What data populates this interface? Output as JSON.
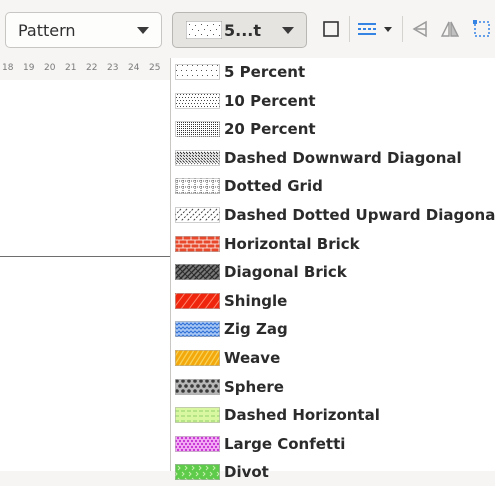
{
  "toolbar": {
    "area_style": {
      "label": "Pattern"
    },
    "pattern": {
      "label": "5...t"
    },
    "icons": [
      "shadow-box-icon",
      "line-style-icon",
      "align-icon",
      "flip-icon",
      "transform-icon"
    ]
  },
  "ruler": {
    "ticks": [
      "18",
      "19",
      "20",
      "21",
      "22",
      "23",
      "24",
      "25"
    ]
  },
  "patterns": [
    {
      "label": "5 Percent",
      "kind": "dots5",
      "fg": "#555555",
      "bg": "#ffffff"
    },
    {
      "label": "10 Percent",
      "kind": "dots10",
      "fg": "#444444",
      "bg": "#ffffff"
    },
    {
      "label": "20 Percent",
      "kind": "dots20",
      "fg": "#333333",
      "bg": "#ffffff"
    },
    {
      "label": "Dashed Downward Diagonal",
      "kind": "diagdown",
      "fg": "#222222",
      "bg": "#ffffff"
    },
    {
      "label": "Dotted Grid",
      "kind": "grid",
      "fg": "#222222",
      "bg": "#ffffff"
    },
    {
      "label": "Dashed Dotted Upward Diagonal",
      "kind": "diagup",
      "fg": "#333333",
      "bg": "#ffffff"
    },
    {
      "label": "Horizontal Brick",
      "kind": "brick",
      "fg": "#ffffff",
      "bg": "#e8472a"
    },
    {
      "label": "Diagonal Brick",
      "kind": "diagbrick",
      "fg": "#2a2a2a",
      "bg": "#7a7a7a"
    },
    {
      "label": "Shingle",
      "kind": "shingle",
      "fg": "#ff8a70",
      "bg": "#f0250d"
    },
    {
      "label": "Zig Zag",
      "kind": "zigzag",
      "fg": "#2f6fd6",
      "bg": "#a9c8f3"
    },
    {
      "label": "Weave",
      "kind": "weave",
      "fg": "#f8d25a",
      "bg": "#f3a90c"
    },
    {
      "label": "Sphere",
      "kind": "sphere",
      "fg": "#3a3a3a",
      "bg": "#b7b7b7"
    },
    {
      "label": "Dashed Horizontal",
      "kind": "dashh",
      "fg": "#8ed16a",
      "bg": "#d9f7a1"
    },
    {
      "label": "Large Confetti",
      "kind": "confetti",
      "fg": "#c93bd6",
      "bg": "#f3a8f3"
    },
    {
      "label": "Divot",
      "kind": "divot",
      "fg": "#c9f1b0",
      "bg": "#5ecb4b"
    }
  ]
}
